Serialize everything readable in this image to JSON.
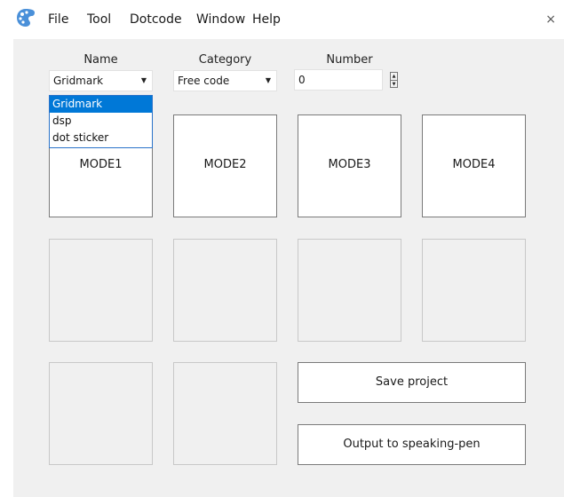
{
  "menu": [
    "File",
    "Tool",
    "Dotcode",
    "Window",
    "Help"
  ],
  "close_glyph": "×",
  "form": {
    "name": {
      "label": "Name",
      "value": "Gridmark",
      "options": [
        "Gridmark",
        "dsp",
        "dot sticker"
      ],
      "selected_index": 0
    },
    "category": {
      "label": "Category",
      "value": "Free code"
    },
    "number": {
      "label": "Number",
      "value": "0"
    }
  },
  "modes": [
    "MODE1",
    "MODE2",
    "MODE3",
    "MODE4"
  ],
  "actions": {
    "save": "Save project",
    "output": "Output to speaking-pen"
  },
  "icons": {
    "app": "app-logo-icon",
    "dropdown": "chevron-down-icon",
    "spin_up": "spin-up-icon",
    "spin_down": "spin-down-icon",
    "close": "close-icon"
  },
  "colors": {
    "accent": "#0078d7",
    "panel": "#f0f0f0",
    "logo": "#4a90d9"
  }
}
